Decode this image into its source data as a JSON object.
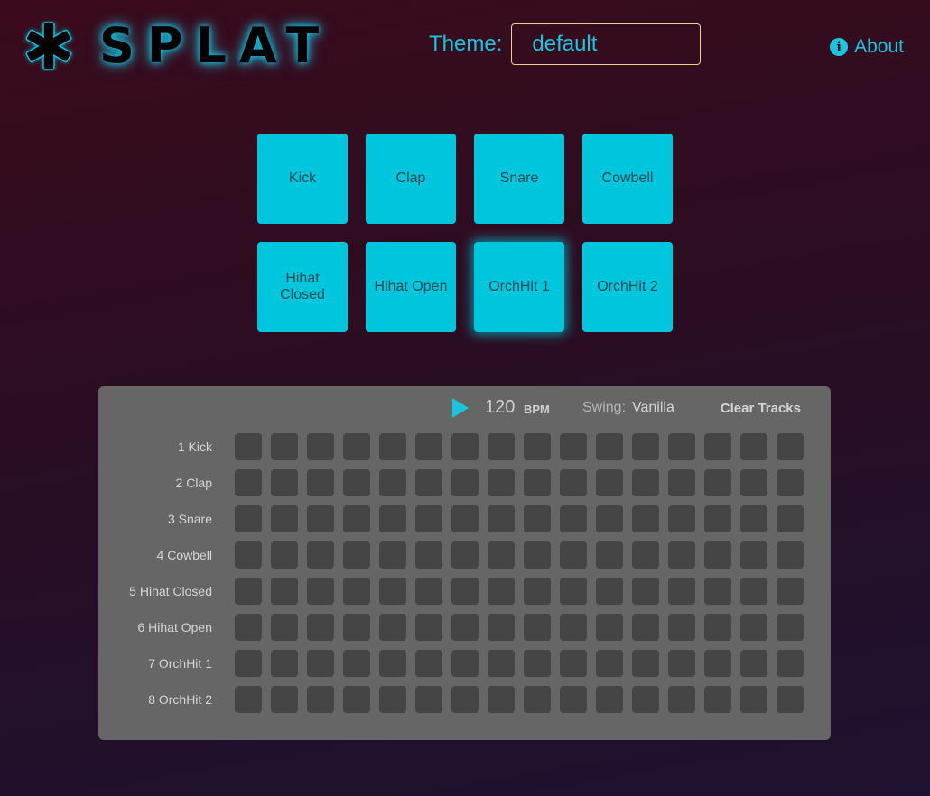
{
  "header": {
    "app_name": "SPLAT",
    "logo_icon": "asterisk-icon",
    "theme_label": "Theme:",
    "theme_value": "default",
    "about_icon": "info-circle-icon",
    "about_label": "About"
  },
  "colors": {
    "accent": "#1ec3de",
    "pad": "#00c6dd",
    "panel": "#666666",
    "step": "#454545"
  },
  "pads": [
    {
      "label": "Kick",
      "active": false
    },
    {
      "label": "Clap",
      "active": false
    },
    {
      "label": "Snare",
      "active": false
    },
    {
      "label": "Cowbell",
      "active": false
    },
    {
      "label": "Hihat Closed",
      "active": false
    },
    {
      "label": "Hihat Open",
      "active": false
    },
    {
      "label": "OrchHit 1",
      "active": true
    },
    {
      "label": "OrchHit 2",
      "active": false
    }
  ],
  "sequencer": {
    "play_icon": "play-icon",
    "bpm": "120",
    "bpm_unit": "BPM",
    "swing_label": "Swing:",
    "swing_value": "Vanilla",
    "clear_label": "Clear Tracks",
    "steps_per_track": 16,
    "tracks": [
      {
        "label": "1 Kick"
      },
      {
        "label": "2 Clap"
      },
      {
        "label": "3 Snare"
      },
      {
        "label": "4 Cowbell"
      },
      {
        "label": "5 Hihat Closed"
      },
      {
        "label": "6 Hihat Open"
      },
      {
        "label": "7 OrchHit 1"
      },
      {
        "label": "8 OrchHit 2"
      }
    ]
  }
}
